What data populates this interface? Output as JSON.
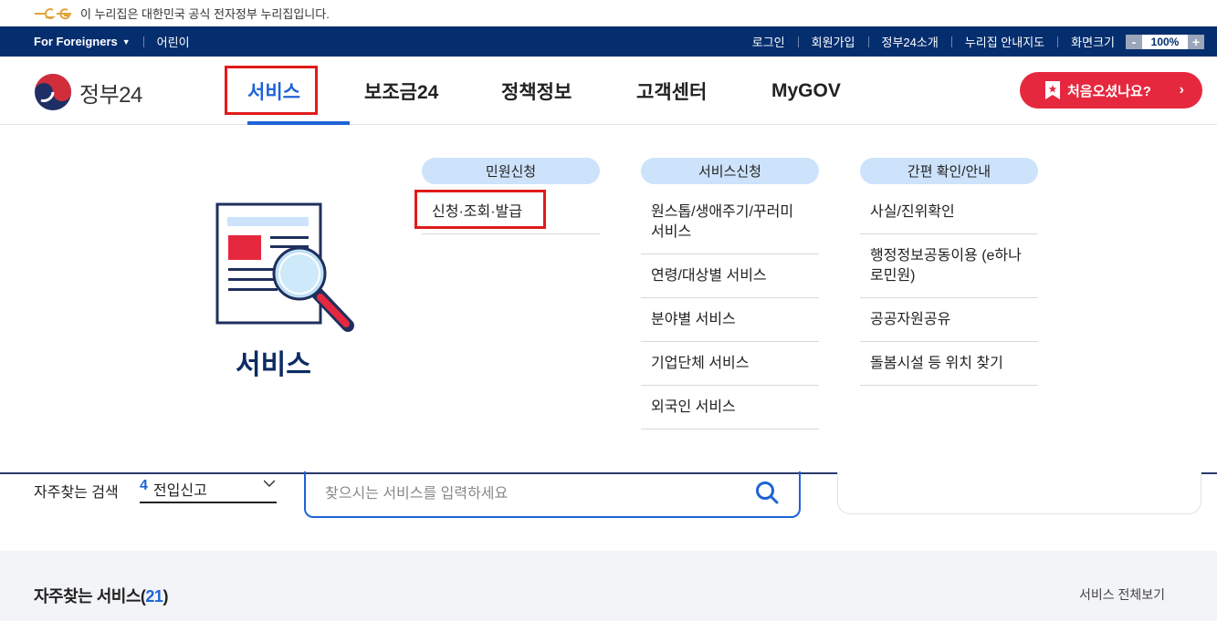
{
  "banner": {
    "text": "이 누리집은 대한민국 공식 전자정부 누리집입니다."
  },
  "util": {
    "foreigners": "For Foreigners",
    "kids": "어린이",
    "links": [
      "로그인",
      "회원가입",
      "정부24소개",
      "누리집 안내지도"
    ],
    "zoom_label": "화면크기",
    "zoom_minus": "-",
    "zoom_value": "100%",
    "zoom_plus": "+"
  },
  "header": {
    "logo_text": "정부24",
    "nav": [
      "서비스",
      "보조금24",
      "정책정보",
      "고객센터",
      "MyGOV"
    ],
    "first_visit": "처음오셨나요?"
  },
  "mega": {
    "title": "서비스",
    "columns": [
      {
        "heading": "민원신청",
        "items": [
          "신청·조회·발급"
        ]
      },
      {
        "heading": "서비스신청",
        "items": [
          "원스톱/생애주기/꾸러미 서비스",
          "연령/대상별 서비스",
          "분야별 서비스",
          "기업단체 서비스",
          "외국인 서비스"
        ]
      },
      {
        "heading": "간편 확인/안내",
        "items": [
          "사실/진위확인",
          "행정정보공동이용 (e하나로민원)",
          "공공자원공유",
          "돌봄시설 등 위치 찾기"
        ]
      }
    ]
  },
  "search": {
    "freq_label": "자주찾는 검색",
    "freq_num": "4",
    "freq_value": "전입신고",
    "placeholder": "찾으시는 서비스를 입력하세요"
  },
  "freq_services": {
    "title": "자주찾는 서비스",
    "count": "21",
    "view_all": "서비스 전체보기"
  },
  "colors": {
    "navy": "#052e6e",
    "accent": "#1e63d6",
    "cta": "#e6283f",
    "highlight": "#e11b1b"
  }
}
